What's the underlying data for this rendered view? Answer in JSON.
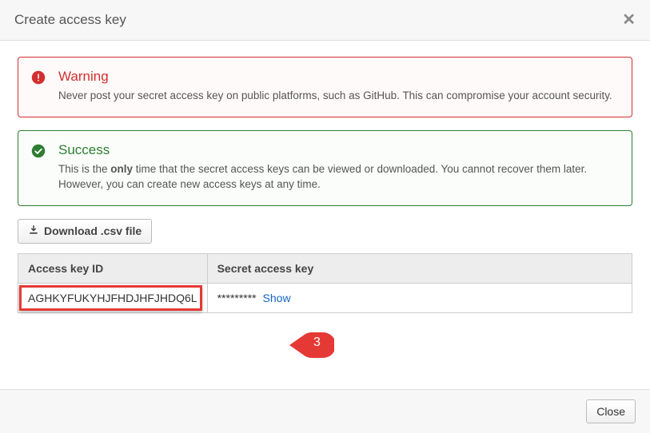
{
  "header": {
    "title": "Create access key"
  },
  "alerts": {
    "warning": {
      "title": "Warning",
      "text": "Never post your secret access key on public platforms, such as GitHub. This can compromise your account security."
    },
    "success": {
      "title": "Success",
      "text_prefix": "This is the ",
      "text_bold": "only",
      "text_suffix": " time that the secret access keys can be viewed or downloaded. You cannot recover them later. However, you can create new access keys at any time."
    }
  },
  "download_button": "Download .csv file",
  "table": {
    "col1": "Access key ID",
    "col2": "Secret access key",
    "row": {
      "id": "AGHKYFUKYHJFHDJHFJHDQ6L",
      "secret_masked": "*********",
      "show": "Show"
    }
  },
  "callout": {
    "number": "3"
  },
  "footer": {
    "close": "Close"
  }
}
